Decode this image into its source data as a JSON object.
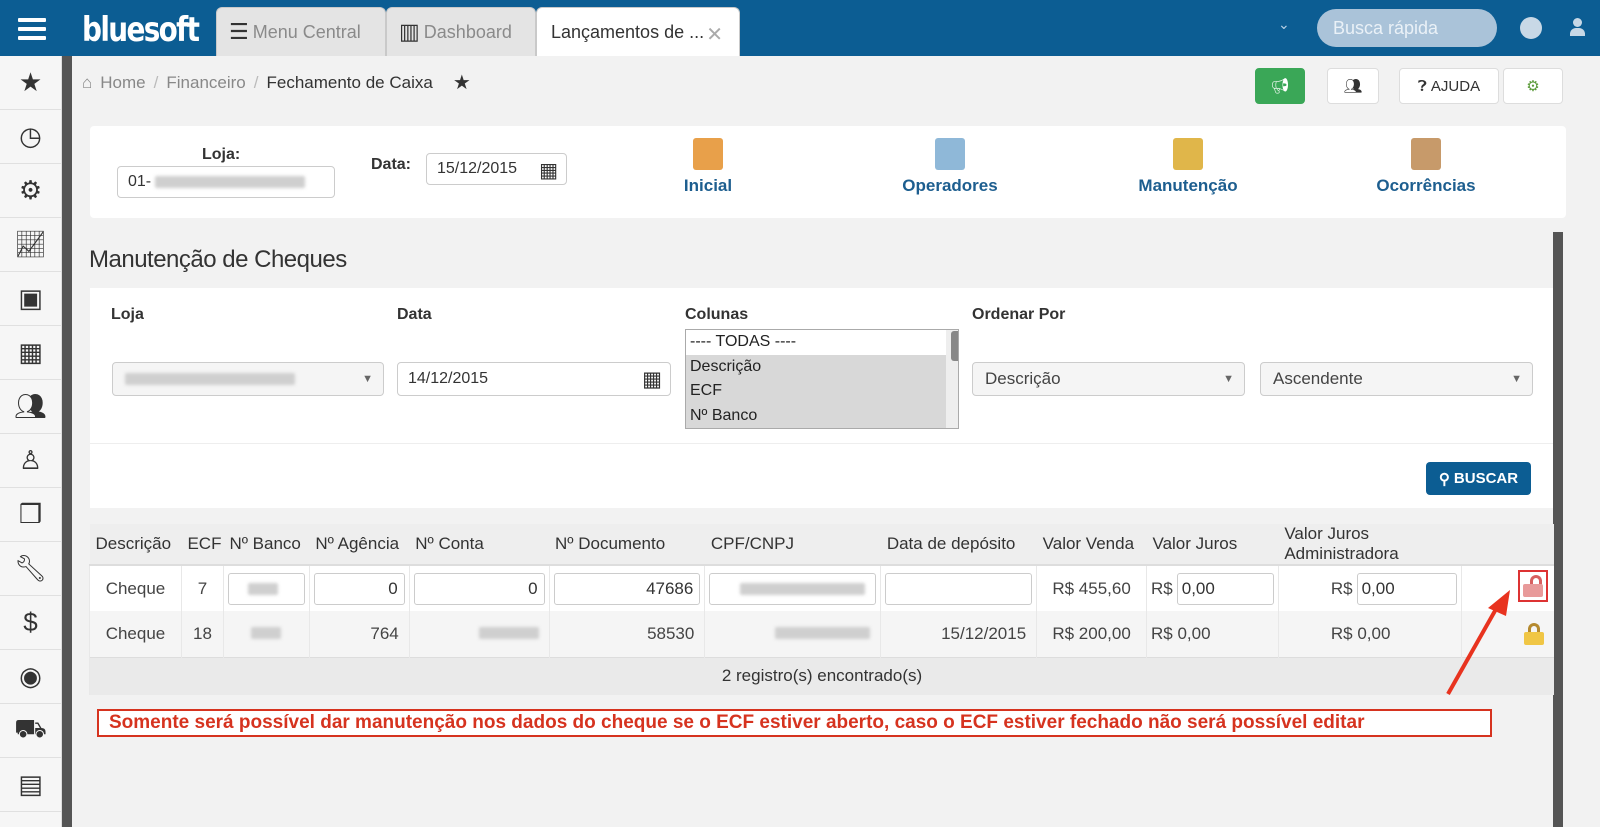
{
  "app": {
    "brand": "bluesoft",
    "search_placeholder": "Busca rápida"
  },
  "tabs": [
    {
      "label": "Menu Central",
      "icon": "list-icon"
    },
    {
      "label": "Dashboard",
      "icon": "bar-chart-icon"
    },
    {
      "label": "Lançamentos de ...",
      "icon": "",
      "active": true
    }
  ],
  "sidebar": {
    "items": [
      "star-icon",
      "clock-icon",
      "gear-icon",
      "line-chart-icon",
      "briefcase-icon",
      "calculator-icon",
      "users-icon",
      "person-icon",
      "cubes-icon",
      "wrench-icon",
      "dollar-icon",
      "lion-icon",
      "truck-icon",
      "building-icon"
    ]
  },
  "breadcrumb": {
    "home": "Home",
    "level1": "Financeiro",
    "current": "Fechamento de Caixa"
  },
  "header_buttons": {
    "help": "AJUDA"
  },
  "top_panel": {
    "loja_label": "Loja:",
    "loja_value_prefix": "01-",
    "data_label": "Data:",
    "data_value": "15/12/2015",
    "nav": [
      "Inicial",
      "Operadores",
      "Manutenção",
      "Ocorrências"
    ]
  },
  "section": {
    "title": "Manutenção de Cheques"
  },
  "filters": {
    "loja_label": "Loja",
    "data_label": "Data",
    "data_value": "14/12/2015",
    "colunas_label": "Colunas",
    "colunas_options": [
      "---- TODAS ----",
      "Descrição",
      "ECF",
      "Nº Banco"
    ],
    "ordenar_label": "Ordenar Por",
    "ordenar_value": "Descrição",
    "direcao_value": "Ascendente",
    "buscar_label": "BUSCAR"
  },
  "table": {
    "headers": [
      "Descrição",
      "ECF",
      "Nº Banco",
      "Nº Agência",
      "Nº Conta",
      "Nº Documento",
      "CPF/CNPJ",
      "Data de depósito",
      "Valor Venda",
      "Valor Juros",
      "Valor Juros Administradora",
      ""
    ],
    "rows": [
      {
        "descricao": "Cheque",
        "ecf": "7",
        "agencia": "0",
        "conta": "0",
        "documento": "47686",
        "data_deposito": "",
        "valor_venda": "R$ 455,60",
        "juros_prefix": "R$",
        "juros": "0,00",
        "juros_adm_prefix": "R$",
        "juros_adm": "0,00",
        "lock": "open"
      },
      {
        "descricao": "Cheque",
        "ecf": "18",
        "agencia": "764",
        "conta": "",
        "documento": "58530",
        "data_deposito": "15/12/2015",
        "valor_venda": "R$ 200,00",
        "juros_prefix": "R$",
        "juros": "0,00",
        "juros_adm_prefix": "R$",
        "juros_adm": "0,00",
        "lock": "closed"
      }
    ],
    "footer": "2 registro(s) encontrado(s)"
  },
  "annotation": "Somente será possível dar manutenção nos dados do cheque se o ECF estiver aberto, caso o ECF estiver fechado não será possível editar",
  "colors": {
    "brand": "#0c5d93",
    "green": "#3aa757",
    "annotation": "#d6331f"
  }
}
